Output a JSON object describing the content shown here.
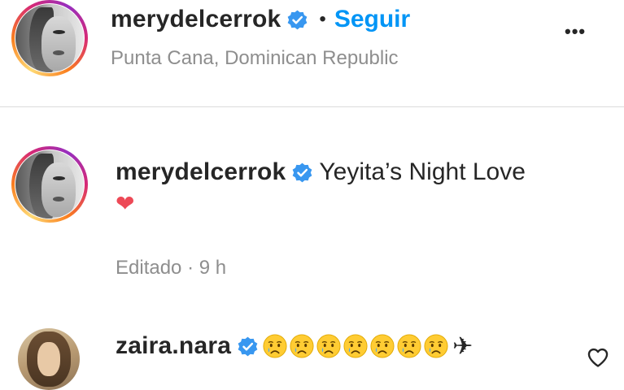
{
  "post_header": {
    "username": "merydelcerrok",
    "separator": "•",
    "follow_label": "Seguir",
    "location": "Punta Cana, Dominican Republic",
    "more_label": "•••"
  },
  "caption": {
    "username": "merydelcerrok",
    "text": "Yeyita’s Night Love",
    "heart": "❤",
    "meta": "Editado · 9 h"
  },
  "comment": {
    "username": "zaira.nara",
    "emoji_count": 7,
    "emoji_name": "crying-face",
    "trailing_glyph": "✈"
  },
  "colors": {
    "link_blue": "#0095f6",
    "verified_blue": "#3897f0",
    "muted": "#8e8e8e",
    "heart_red": "#ed4956"
  },
  "icons": [
    "verified-badge-icon",
    "more-options-icon",
    "heart-icon",
    "crying-face-icon",
    "airplane-icon",
    "like-heart-icon"
  ]
}
